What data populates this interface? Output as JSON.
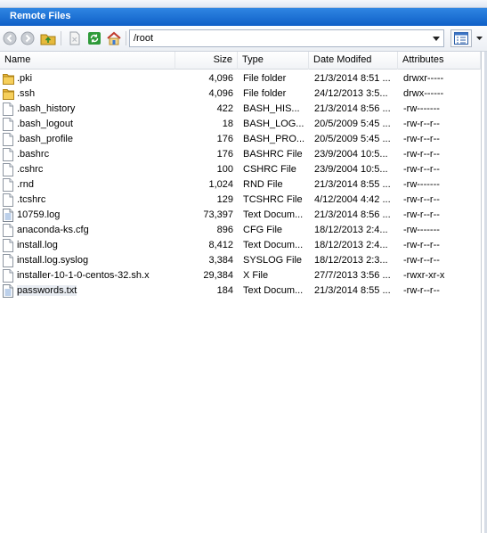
{
  "window": {
    "title": "Remote Files"
  },
  "toolbar": {
    "back_icon": "back-icon",
    "forward_icon": "forward-icon",
    "up_folder_icon": "up-folder-icon",
    "delete_icon": "delete-icon",
    "refresh_icon": "refresh-icon",
    "home_icon": "home-icon",
    "path": "/root",
    "view_icon": "view-mode-icon"
  },
  "columns": {
    "name": "Name",
    "size": "Size",
    "type": "Type",
    "date": "Date Modifed",
    "attributes": "Attributes"
  },
  "files": [
    {
      "name": ".pki",
      "size": "4,096",
      "type": "File folder",
      "date": "21/3/2014 8:51 ...",
      "attr": "drwxr-----",
      "kind": "folder"
    },
    {
      "name": ".ssh",
      "size": "4,096",
      "type": "File folder",
      "date": "24/12/2013 3:5...",
      "attr": "drwx------",
      "kind": "folder"
    },
    {
      "name": ".bash_history",
      "size": "422",
      "type": "BASH_HIS...",
      "date": "21/3/2014 8:56 ...",
      "attr": "-rw-------",
      "kind": "file"
    },
    {
      "name": ".bash_logout",
      "size": "18",
      "type": "BASH_LOG...",
      "date": "20/5/2009 5:45 ...",
      "attr": "-rw-r--r--",
      "kind": "file"
    },
    {
      "name": ".bash_profile",
      "size": "176",
      "type": "BASH_PRO...",
      "date": "20/5/2009 5:45 ...",
      "attr": "-rw-r--r--",
      "kind": "file"
    },
    {
      "name": ".bashrc",
      "size": "176",
      "type": "BASHRC File",
      "date": "23/9/2004 10:5...",
      "attr": "-rw-r--r--",
      "kind": "file"
    },
    {
      "name": ".cshrc",
      "size": "100",
      "type": "CSHRC File",
      "date": "23/9/2004 10:5...",
      "attr": "-rw-r--r--",
      "kind": "file"
    },
    {
      "name": ".rnd",
      "size": "1,024",
      "type": "RND File",
      "date": "21/3/2014 8:55 ...",
      "attr": "-rw-------",
      "kind": "file"
    },
    {
      "name": ".tcshrc",
      "size": "129",
      "type": "TCSHRC File",
      "date": "4/12/2004 4:42 ...",
      "attr": "-rw-r--r--",
      "kind": "file"
    },
    {
      "name": "10759.log",
      "size": "73,397",
      "type": "Text Docum...",
      "date": "21/3/2014 8:56 ...",
      "attr": "-rw-r--r--",
      "kind": "text"
    },
    {
      "name": "anaconda-ks.cfg",
      "size": "896",
      "type": "CFG File",
      "date": "18/12/2013 2:4...",
      "attr": "-rw-------",
      "kind": "file"
    },
    {
      "name": "install.log",
      "size": "8,412",
      "type": "Text Docum...",
      "date": "18/12/2013 2:4...",
      "attr": "-rw-r--r--",
      "kind": "file"
    },
    {
      "name": "install.log.syslog",
      "size": "3,384",
      "type": "SYSLOG File",
      "date": "18/12/2013 2:3...",
      "attr": "-rw-r--r--",
      "kind": "file"
    },
    {
      "name": "installer-10-1-0-centos-32.sh.x",
      "size": "29,384",
      "type": "X File",
      "date": "27/7/2013 3:56 ...",
      "attr": "-rwxr-xr-x",
      "kind": "file"
    },
    {
      "name": "passwords.txt",
      "size": "184",
      "type": "Text Docum...",
      "date": "21/3/2014 8:55 ...",
      "attr": "-rw-r--r--",
      "kind": "text"
    }
  ],
  "selected_row": 14
}
